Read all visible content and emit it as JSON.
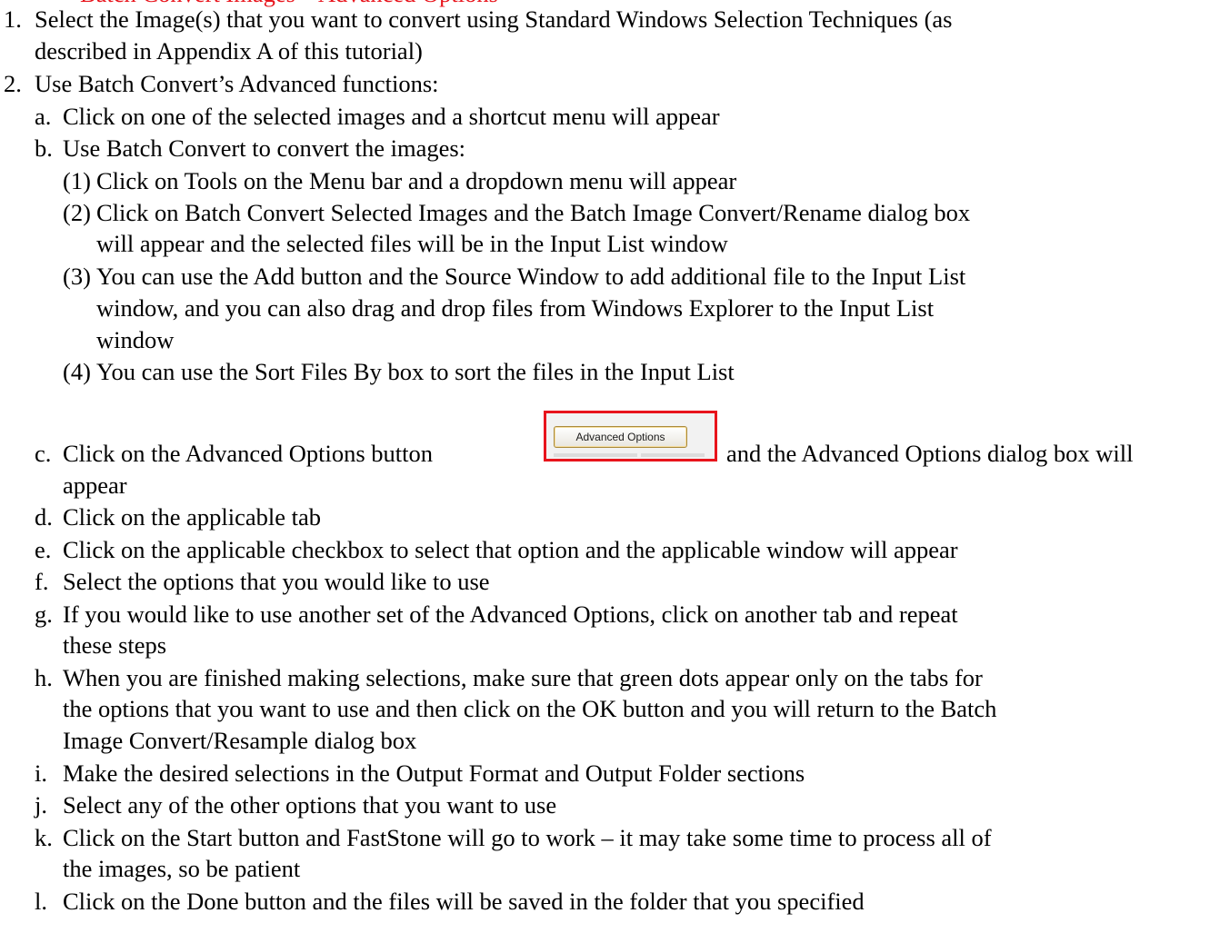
{
  "heading_fragment": "Batch Convert Images – Advanced Options",
  "steps": {
    "s1": {
      "num": "1.",
      "line1": "Select the Image(s) that you want to convert using Standard Windows Selection Techniques (as",
      "line2": "described in Appendix A of this tutorial)"
    },
    "s2": {
      "num": "2.",
      "line1": "Use Batch Convert’s Advanced functions:"
    },
    "a": {
      "num": "a.",
      "line1": "Click on one of the selected images and a shortcut menu will appear"
    },
    "b": {
      "num": "b.",
      "line1": "Use Batch Convert to convert the images:"
    },
    "b1": {
      "num": "(1)",
      "line1": "Click on Tools on the Menu bar and a dropdown menu will appear"
    },
    "b2": {
      "num": "(2)",
      "line1": "Click on Batch Convert Selected Images and the Batch Image Convert/Rename dialog box",
      "line2": "will appear and the selected files will be in the Input List window"
    },
    "b3": {
      "num": "(3)",
      "line1": "You can use the Add button and the Source Window to add additional file to the Input List",
      "line2": "window, and you can also drag and drop files from Windows Explorer to the Input List",
      "line3": "window"
    },
    "b4": {
      "num": "(4)",
      "line1": "You can use the Sort Files By box to sort the files in the Input List"
    },
    "c": {
      "num": "c.",
      "line1_pre": "Click on the Advanced Options button",
      "button_label": "Advanced Options",
      "line1_post": "and the Advanced Options dialog box will",
      "line2": "appear"
    },
    "d": {
      "num": "d.",
      "line1": "Click on the applicable tab"
    },
    "e": {
      "num": "e.",
      "line1": "Click on the applicable checkbox to select that option and the applicable window will appear"
    },
    "f": {
      "num": "f.",
      "line1": "Select the options that you would like to use"
    },
    "g": {
      "num": "g.",
      "line1": "If you would like to use another set of the Advanced Options, click on another tab and repeat",
      "line2": "these steps"
    },
    "h": {
      "num": "h.",
      "line1": "When you are finished making selections, make sure that green dots appear only on the tabs for",
      "line2": "the options that you want to use and then click on the OK button and you will return to the Batch",
      "line3": "Image Convert/Resample dialog box"
    },
    "i": {
      "num": "i.",
      "line1": "Make the desired selections in the Output Format and Output Folder sections"
    },
    "j": {
      "num": "j.",
      "line1": "Select any of the other options that you want to use"
    },
    "k": {
      "num": "k.",
      "line1": "Click on the Start button and FastStone will go to work – it may take some time to process all of",
      "line2": "the images, so be patient"
    },
    "l": {
      "num": "l.",
      "line1": "Click on the Done button and the files will be saved in the folder that you specified"
    }
  }
}
